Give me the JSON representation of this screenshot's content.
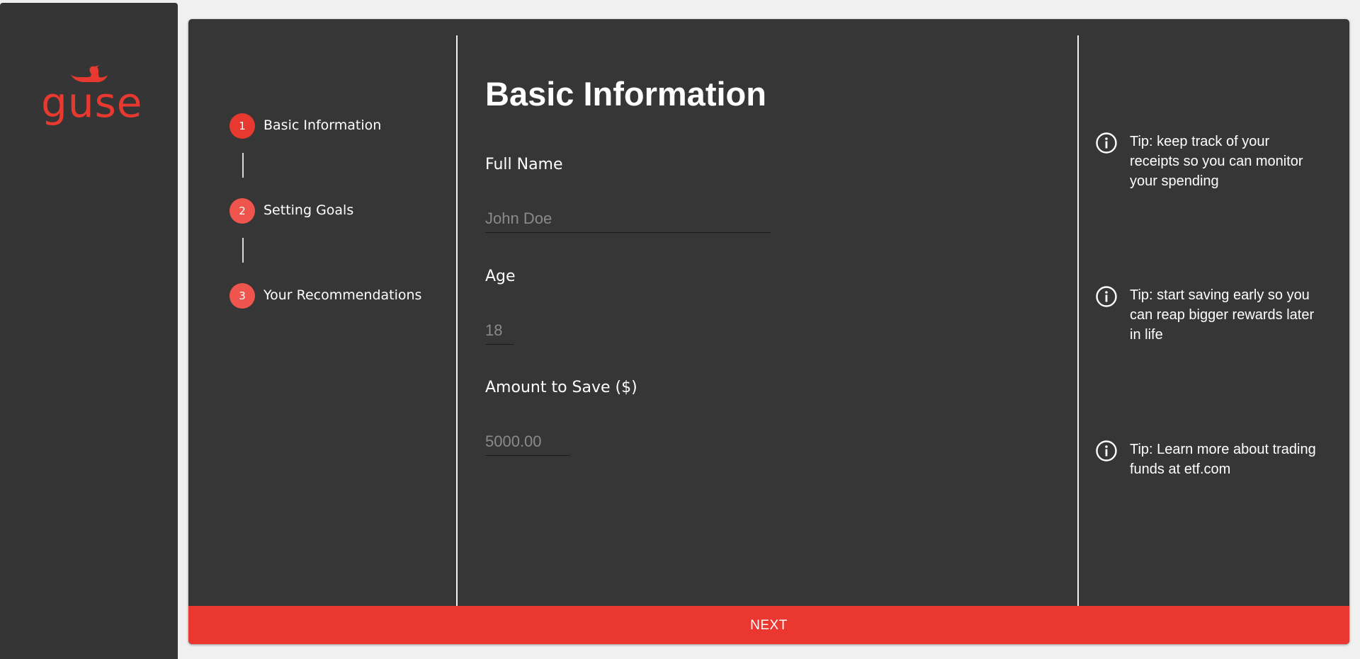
{
  "app": {
    "logo_text": "guse"
  },
  "stepper": {
    "steps": [
      {
        "number": "1",
        "label": "Basic Information",
        "active": true
      },
      {
        "number": "2",
        "label": "Setting Goals",
        "active": false
      },
      {
        "number": "3",
        "label": "Your Recommendations",
        "active": false
      }
    ]
  },
  "form": {
    "title": "Basic Information",
    "full_name": {
      "label": "Full Name",
      "placeholder": "John Doe",
      "value": ""
    },
    "age": {
      "label": "Age",
      "placeholder": "18",
      "value": ""
    },
    "amount": {
      "label": "Amount to Save ($)",
      "placeholder": "5000.00",
      "value": ""
    }
  },
  "tips": [
    {
      "icon": "info-icon",
      "text": "Tip: keep track of your receipts so you can monitor your spending"
    },
    {
      "icon": "info-icon",
      "text": "Tip: start saving early so you can reap bigger rewards later in life"
    },
    {
      "icon": "info-icon",
      "text": "Tip: Learn more about trading funds at etf.com"
    }
  ],
  "footer": {
    "next_label": "NEXT"
  },
  "colors": {
    "accent": "#ea3830",
    "step_active": "#e7392f",
    "step_inactive": "#f0554d",
    "panel": "#363636",
    "sidebar": "#353535"
  }
}
